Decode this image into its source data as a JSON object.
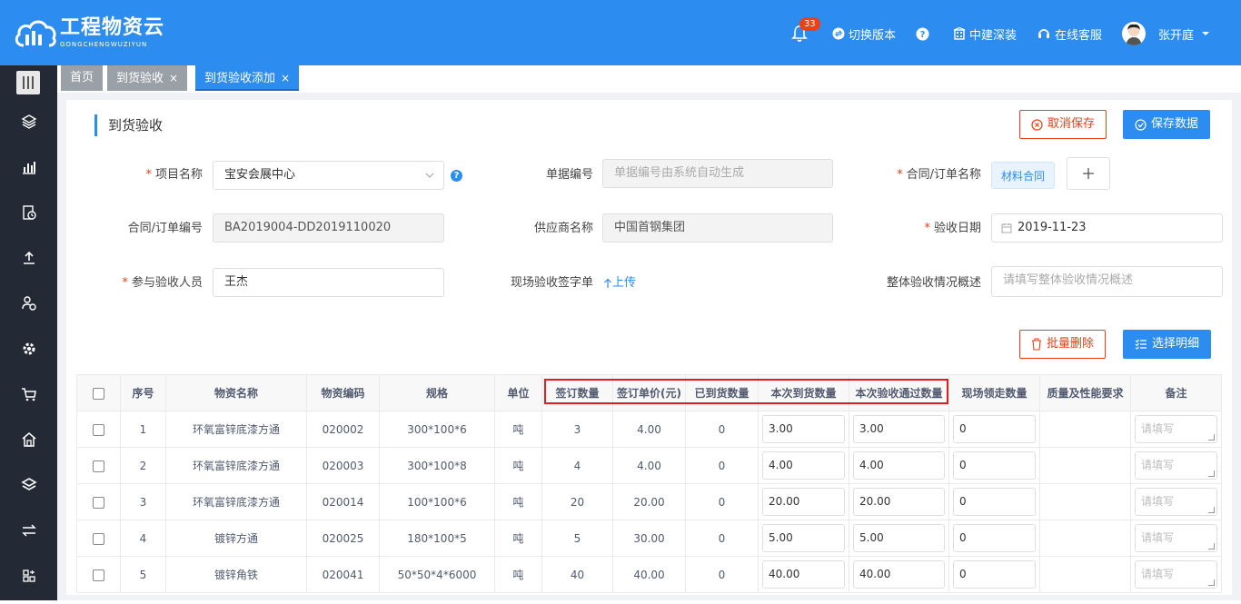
{
  "header": {
    "logo_title": "工程物资云",
    "logo_sub": "GONGCHENGWUZIYUN",
    "notifications": "33",
    "switch_version": "切换版本",
    "org": "中建深装",
    "online_service": "在线客服",
    "user_name": "张开庭"
  },
  "tabs": [
    {
      "label": "首页"
    },
    {
      "label": "到货验收"
    },
    {
      "label": "到货验收添加"
    }
  ],
  "page": {
    "title": "到货验收",
    "cancel_save": "取消保存",
    "save_data": "保存数据"
  },
  "form": {
    "project_label": "项目名称",
    "project_value": "宝安会展中心",
    "doc_no_label": "单据编号",
    "doc_no_placeholder": "单据编号由系统自动生成",
    "contract_name_label": "合同/订单名称",
    "contract_tag": "材料合同",
    "contract_no_label": "合同/订单编号",
    "contract_no_value": "BA2019004-DD2019110020",
    "supplier_label": "供应商名称",
    "supplier_value": "中国首钢集团",
    "date_label": "验收日期",
    "date_value": "2019-11-23",
    "participant_label": "参与验收人员",
    "participant_value": "王杰",
    "sign_label": "现场验收签字单",
    "upload_label": "上传",
    "summary_label": "整体验收情况概述",
    "summary_placeholder": "请填写整体验收情况概述"
  },
  "actions": {
    "batch_delete": "批量删除",
    "select_detail": "选择明细"
  },
  "table": {
    "headers": [
      "序号",
      "物资名称",
      "物资编码",
      "规格",
      "单位",
      "签订数量",
      "签订单价(元)",
      "已到货数量",
      "本次到货数量",
      "本次验收通过数量",
      "现场领走数量",
      "质量及性能要求",
      "备注"
    ],
    "remark_placeholder": "请填写",
    "rows": [
      {
        "no": "1",
        "name": "环氧富锌底漆方通",
        "code": "020002",
        "spec": "300*100*6",
        "unit": "吨",
        "qty": "3",
        "price": "4.00",
        "arrived": "0",
        "this_arrival": "3.00",
        "this_pass": "3.00",
        "taken": "0"
      },
      {
        "no": "2",
        "name": "环氧富锌底漆方通",
        "code": "020003",
        "spec": "300*100*8",
        "unit": "吨",
        "qty": "4",
        "price": "4.00",
        "arrived": "0",
        "this_arrival": "4.00",
        "this_pass": "4.00",
        "taken": "0"
      },
      {
        "no": "3",
        "name": "环氧富锌底漆方通",
        "code": "020014",
        "spec": "100*100*6",
        "unit": "吨",
        "qty": "20",
        "price": "20.00",
        "arrived": "0",
        "this_arrival": "20.00",
        "this_pass": "20.00",
        "taken": "0"
      },
      {
        "no": "4",
        "name": "镀锌方通",
        "code": "020025",
        "spec": "180*100*5",
        "unit": "吨",
        "qty": "5",
        "price": "30.00",
        "arrived": "0",
        "this_arrival": "5.00",
        "this_pass": "5.00",
        "taken": "0"
      },
      {
        "no": "5",
        "name": "镀锌角铁",
        "code": "020041",
        "spec": "50*50*4*6000",
        "unit": "吨",
        "qty": "40",
        "price": "40.00",
        "arrived": "0",
        "this_arrival": "40.00",
        "this_pass": "40.00",
        "taken": "0"
      }
    ]
  },
  "colors": {
    "primary": "#2d8cf0",
    "sidebar": "#232a36",
    "danger": "#ed4014",
    "highlight_frame": "#e02020"
  }
}
